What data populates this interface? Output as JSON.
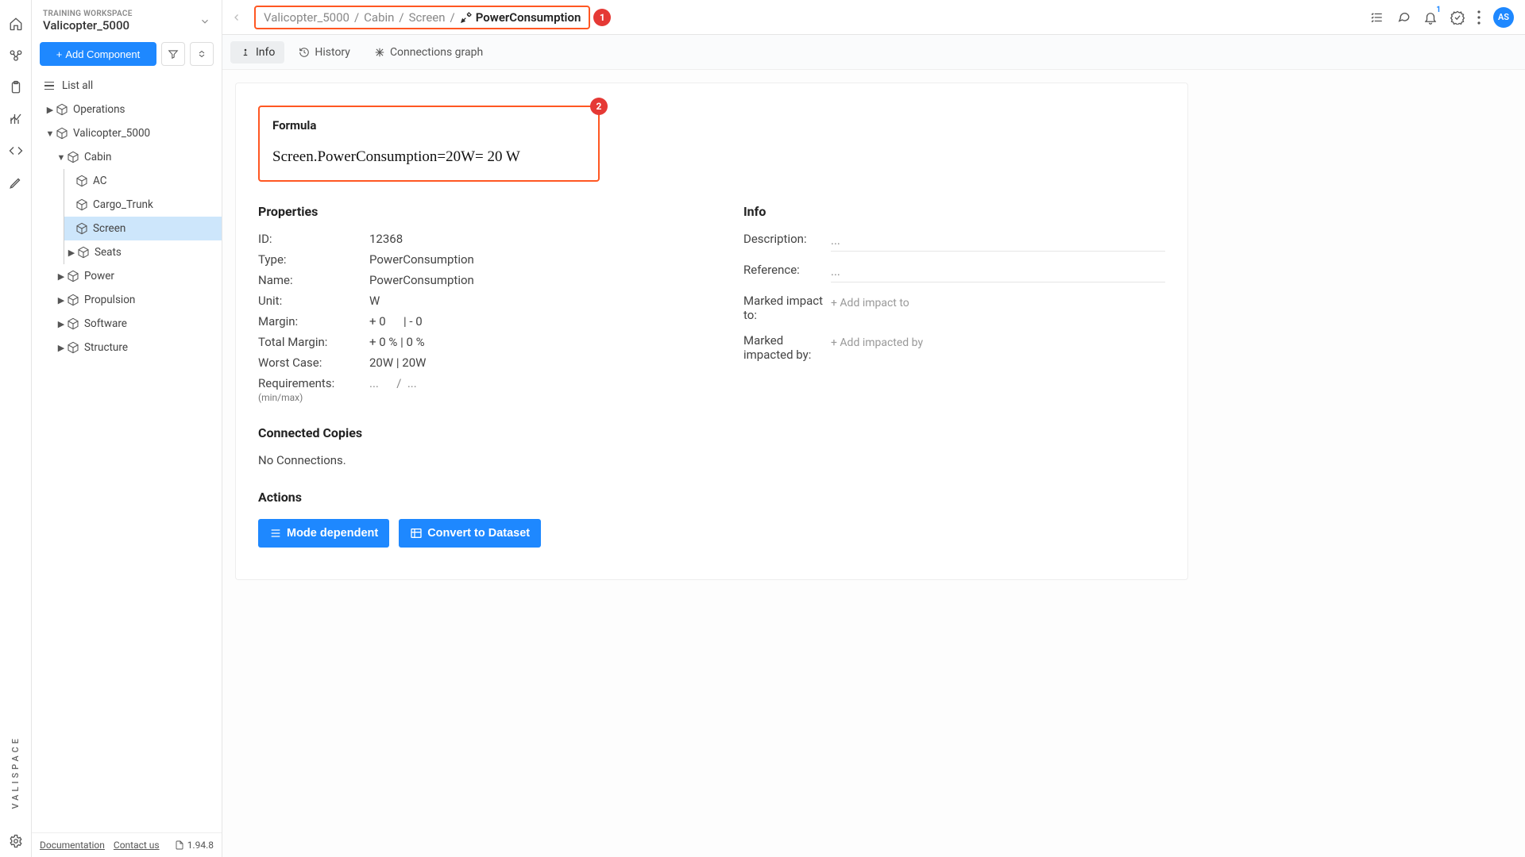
{
  "workspace": {
    "label": "TRAINING WORKSPACE",
    "name": "Valicopter_5000"
  },
  "sidebar": {
    "add_component": "Add Component",
    "list_all": "List all",
    "tree": {
      "operations": "Operations",
      "root": "Valicopter_5000",
      "cabin": "Cabin",
      "ac": "AC",
      "cargo": "Cargo_Trunk",
      "screen": "Screen",
      "seats": "Seats",
      "power": "Power",
      "propulsion": "Propulsion",
      "software": "Software",
      "structure": "Structure"
    },
    "footer": {
      "doc": "Documentation",
      "contact": "Contact us",
      "version": "1.94.8"
    }
  },
  "brand": "VALISPACE",
  "breadcrumb": {
    "p1": "Valicopter_5000",
    "p2": "Cabin",
    "p3": "Screen",
    "current": "PowerConsumption",
    "sep": "/"
  },
  "callouts": {
    "one": "1",
    "two": "2"
  },
  "notif_count": "1",
  "avatar": "AS",
  "tabs": {
    "info": "Info",
    "history": "History",
    "conn": "Connections graph"
  },
  "formula": {
    "title": "Formula",
    "equation": "Screen.PowerConsumption=20W= 20 W"
  },
  "properties": {
    "heading": "Properties",
    "id_k": "ID:",
    "id_v": "12368",
    "type_k": "Type:",
    "type_v": "PowerConsumption",
    "name_k": "Name:",
    "name_v": "PowerConsumption",
    "unit_k": "Unit:",
    "unit_v": "W",
    "margin_k": "Margin:",
    "margin_v": "+ 0      | - 0",
    "tmargin_k": "Total Margin:",
    "tmargin_v": "+ 0 % | 0 %",
    "worst_k": "Worst Case:",
    "worst_v": "20W | 20W",
    "req_k": "Requirements:",
    "req_v": "...      /  ...",
    "req_sub": "(min/max)"
  },
  "info": {
    "heading": "Info",
    "desc_k": "Description:",
    "desc_v": "...",
    "ref_k": "Reference:",
    "ref_v": "...",
    "impact_to_k": "Marked impact to:",
    "impact_to_v": "+ Add impact to",
    "impacted_by_k": "Marked impacted by:",
    "impacted_by_v": "+ Add impacted by"
  },
  "connected": {
    "heading": "Connected Copies",
    "text": "No Connections."
  },
  "actions": {
    "heading": "Actions",
    "mode": "Mode dependent",
    "convert": "Convert to Dataset"
  }
}
